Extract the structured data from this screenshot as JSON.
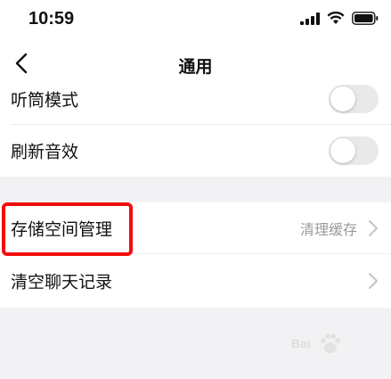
{
  "status_bar": {
    "time": "10:59",
    "icons": [
      "signal-icon",
      "wifi-icon",
      "battery-icon"
    ]
  },
  "nav": {
    "title": "通用",
    "back_icon": "chevron-left-icon"
  },
  "settings_group_1": {
    "rows": [
      {
        "label": "听筒模式",
        "toggle_on": false
      },
      {
        "label": "刷新音效",
        "toggle_on": false
      }
    ]
  },
  "settings_group_2": {
    "rows": [
      {
        "label": "存储空间管理",
        "value": "清理缓存",
        "chevron": "chevron-right-icon"
      },
      {
        "label": "清空聊天记录",
        "value": "",
        "chevron": "chevron-right-icon"
      }
    ]
  },
  "annotation": {
    "color": "#f20d0d"
  },
  "watermark": {
    "text": "Bai"
  },
  "colors": {
    "background": "#f2f2f4",
    "card": "#ffffff",
    "toggle_off": "#e9e9eb",
    "secondary_text": "#9a9a9a"
  }
}
